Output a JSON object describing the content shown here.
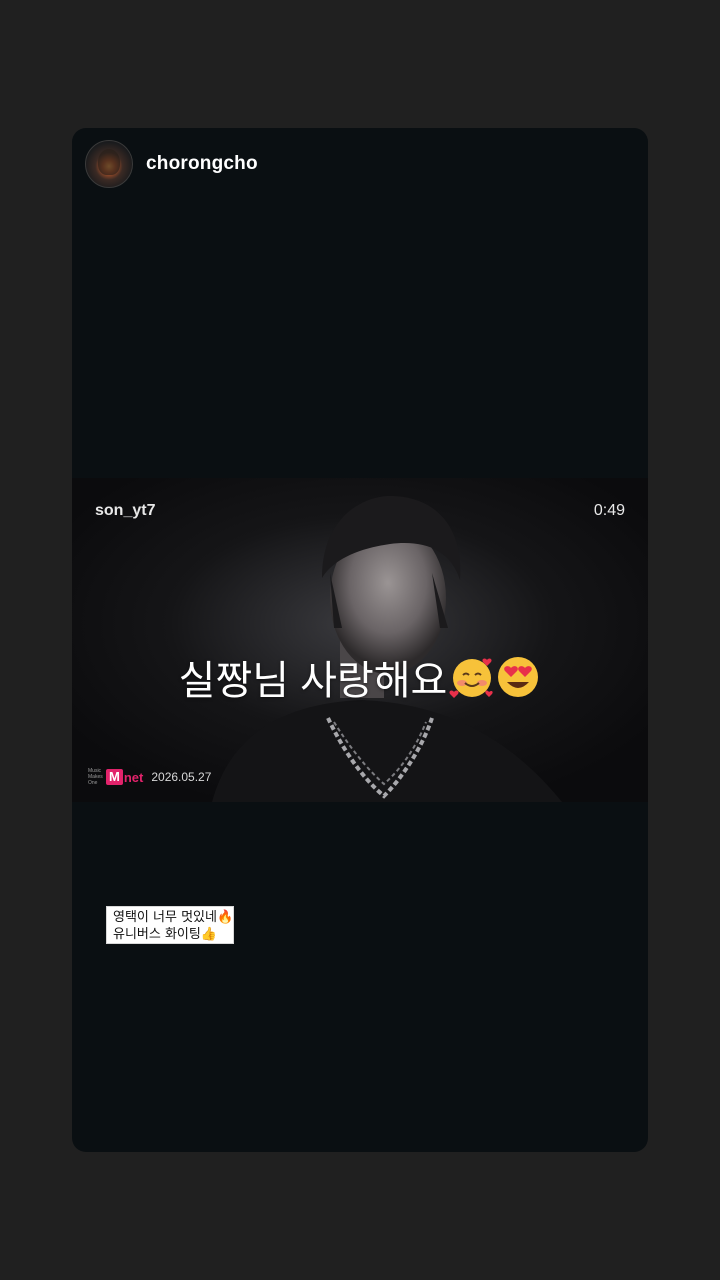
{
  "story": {
    "username": "chorongcho",
    "avatar_icon": "profile-avatar"
  },
  "video": {
    "username": "son_yt7",
    "duration": "0:49",
    "caption_text": "실짱님 사랑해요",
    "caption_emojis": [
      "smiling-face-with-hearts",
      "heart-eyes"
    ],
    "watermark_small": "Music Makes One",
    "watermark_logo_m": "M",
    "watermark_logo_net": "net",
    "watermark_date": "2026.05.27"
  },
  "sticker": {
    "line1": "영택이 너무 멋있네🔥",
    "line2": "유니버스 화이팅👍"
  },
  "colors": {
    "background": "#202020",
    "card": "#0a0f12",
    "brand": "#e2236b"
  }
}
